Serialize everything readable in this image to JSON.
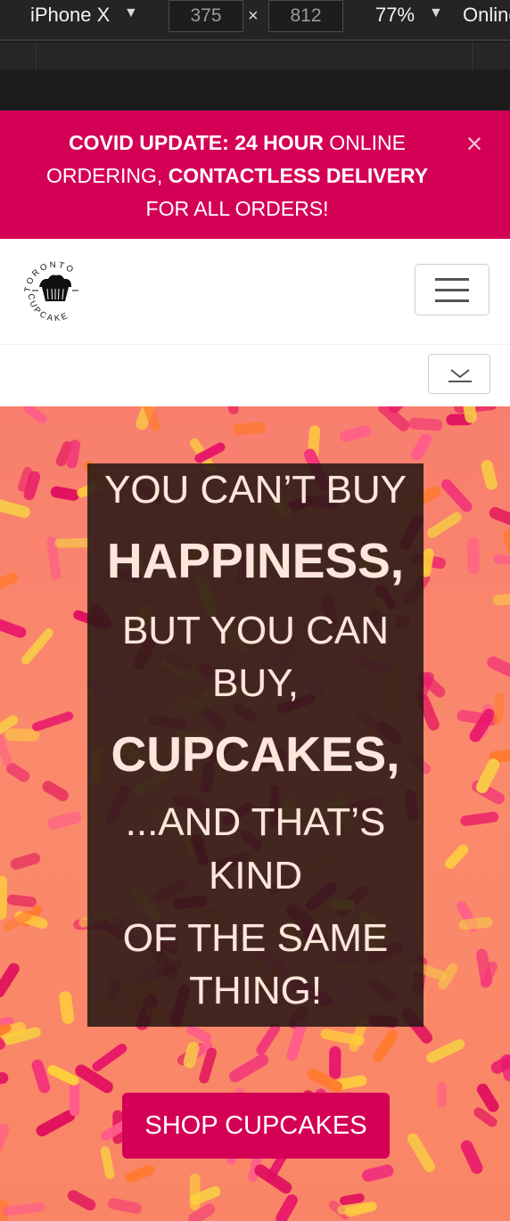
{
  "devtools": {
    "device": "iPhone X",
    "width": "375",
    "height": "812",
    "zoom": "77%",
    "network": "Online",
    "caret_icon": "caret-down-icon",
    "times_symbol": "×"
  },
  "banner": {
    "line1_bold": "COVID UPDATE: 24 HOUR",
    "line1_rest": " ONLINE",
    "line2_rest": "ORDERING, ",
    "line2_bold": "CONTACTLESS DELIVERY",
    "line3": "FOR ALL ORDERS!",
    "close_symbol": "×",
    "close_icon": "close-icon",
    "background": "#d40055"
  },
  "header": {
    "logo_top": "TORONTO",
    "logo_bottom": "CUPCAKE",
    "menu_icon": "hamburger-icon",
    "dropdown_icon": "chevron-down-icon"
  },
  "hero": {
    "lines": [
      "YOU CAN’T BUY",
      "HAPPINESS,",
      "BUT YOU CAN",
      "BUY,",
      "CUPCAKES,",
      "...AND THAT’S",
      "KIND",
      "OF THE SAME",
      "THING!"
    ],
    "cta": "SHOP CUPCAKES",
    "accent": "#d40055"
  }
}
